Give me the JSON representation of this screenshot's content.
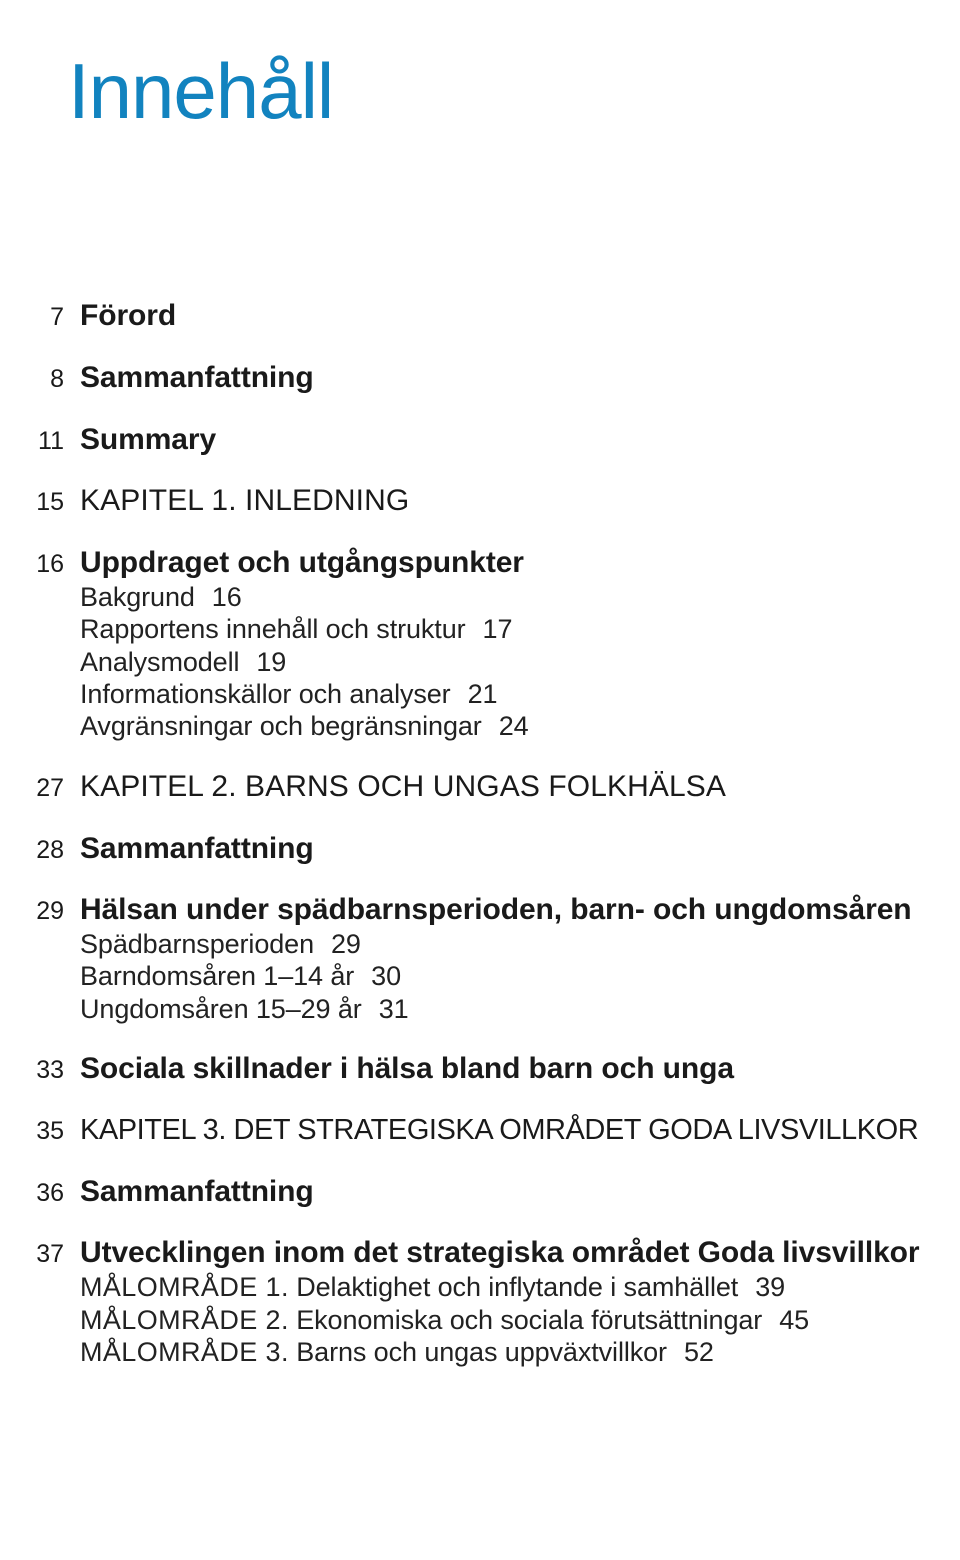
{
  "document": {
    "title": "Innehåll",
    "title_color": "#1283bf",
    "background_color": "#ffffff",
    "text_color": "#1a1a1a",
    "language": "sv"
  },
  "toc": {
    "entries": [
      {
        "page": "7",
        "text": "Förord",
        "level": 1
      },
      {
        "page": "8",
        "text": "Sammanfattning",
        "level": 1
      },
      {
        "page": "11",
        "text": "Summary",
        "level": 1
      },
      {
        "page": "15",
        "text": "KAPITEL 1. INLEDNING",
        "level": 1,
        "style": "caps"
      },
      {
        "page": "16",
        "text": "Uppdraget och utgångspunkter",
        "level": 1
      },
      {
        "page": "16",
        "text": "Bakgrund",
        "level": 2,
        "inline_page": "16"
      },
      {
        "page": "17",
        "text": "Rapportens innehåll och struktur",
        "level": 2,
        "inline_page": "17"
      },
      {
        "page": "19",
        "text": "Analysmodell",
        "level": 2,
        "inline_page": "19"
      },
      {
        "page": "21",
        "text": "Informationskällor och analyser",
        "level": 2,
        "inline_page": "21"
      },
      {
        "page": "24",
        "text": "Avgränsningar och begränsningar",
        "level": 2,
        "inline_page": "24"
      },
      {
        "page": "27",
        "text": "KAPITEL 2. BARNS OCH UNGAS FOLKHÄLSA",
        "level": 1,
        "style": "caps"
      },
      {
        "page": "28",
        "text": "Sammanfattning",
        "level": 1
      },
      {
        "page": "29",
        "text": "Hälsan under spädbarnsperioden, barn- och ungdomsåren",
        "level": 1
      },
      {
        "page": "29",
        "text": "Spädbarnsperioden",
        "level": 2,
        "inline_page": "29"
      },
      {
        "page": "30",
        "text": "Barndomsåren 1–14 år",
        "level": 2,
        "inline_page": "30"
      },
      {
        "page": "31",
        "text": "Ungdomsåren 15–29 år",
        "level": 2,
        "inline_page": "31"
      },
      {
        "page": "33",
        "text": "Sociala skillnader i hälsa bland barn och unga",
        "level": 1
      },
      {
        "page": "35",
        "text": "KAPITEL 3. DET STRATEGISKA OMRÅDET GODA LIVSVILLKOR",
        "level": 1,
        "style": "caps-tight"
      },
      {
        "page": "36",
        "text": "Sammanfattning",
        "level": 1
      },
      {
        "page": "37",
        "text": "Utvecklingen inom det strategiska området Goda livsvillkor",
        "level": 1
      },
      {
        "page": "39",
        "text": "MÅLOMRÅDE 1. Delaktighet och inflytande i samhället",
        "level": 2,
        "inline_page": "39",
        "smallcaps_prefix": "MÅLOMRÅDE 1.",
        "rest": " Delaktighet och inflytande i samhället"
      },
      {
        "page": "45",
        "text": "MÅLOMRÅDE 2. Ekonomiska och sociala förutsättningar",
        "level": 2,
        "inline_page": "45",
        "smallcaps_prefix": "MÅLOMRÅDE 2.",
        "rest": " Ekonomiska och sociala förutsättningar"
      },
      {
        "page": "52",
        "text": "MÅLOMRÅDE 3. Barns och ungas uppväxtvillkor",
        "level": 2,
        "inline_page": "52",
        "smallcaps_prefix": "MÅLOMRÅDE 3.",
        "rest": " Barns och ungas uppväxtvillkor"
      }
    ]
  }
}
